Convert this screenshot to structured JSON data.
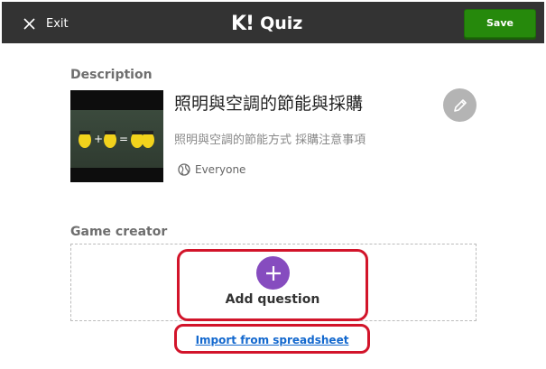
{
  "header": {
    "exit_label": "Exit",
    "logo_text": "K!",
    "app_name": "Quiz",
    "save_label": "Save"
  },
  "description": {
    "section_title": "Description",
    "quiz_title": "照明與空調的節能與採購",
    "quiz_description": "照明與空調的節能方式 採購注意事項",
    "visibility": "Everyone"
  },
  "creator": {
    "section_title": "Game creator",
    "add_question_label": "Add question",
    "import_label": "Import from spreadsheet"
  },
  "icons": {
    "exit": "close-icon",
    "edit": "pencil-icon",
    "add": "plus-icon",
    "visibility": "globe-icon"
  },
  "colors": {
    "header_bg": "#333333",
    "save_green": "#26890c",
    "plus_purple": "#864cbf",
    "highlight_red": "#d2142a",
    "link_blue": "#1368ce"
  }
}
